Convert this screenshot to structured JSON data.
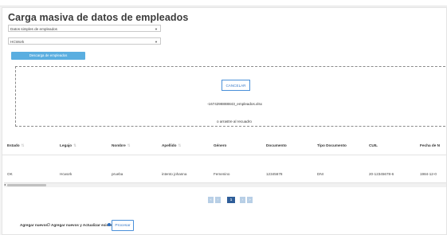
{
  "page": {
    "title": "Carga masiva de datos de empleados"
  },
  "selects": {
    "type_value": "Datos simples de empleados",
    "company_value": "HCWork"
  },
  "buttons": {
    "download": "Descarga de empleados",
    "cancel": "CANCELAR",
    "process": "Procesar"
  },
  "dropzone": {
    "filename": "-1674298888843_empleados.xlsx",
    "drag_text": "o arrastre al recuadro"
  },
  "table": {
    "columns": [
      "Estado",
      "Legajo",
      "Nombre",
      "Apellido",
      "Género",
      "Documento",
      "Tipo Documento",
      "CUIL",
      "Fecha de N"
    ],
    "sortable": [
      true,
      true,
      true,
      true,
      false,
      false,
      false,
      false,
      false
    ],
    "rows": [
      [
        "OK",
        "Hcwork",
        "prueba",
        "intento johanna",
        "Femenino",
        "12345678",
        "DNI",
        "20-12345678-6",
        "1984-12-0"
      ]
    ]
  },
  "pagination": {
    "current_page": "1"
  },
  "footer": {
    "add_new_label": "Agregar nuevos",
    "add_update_label": "Agregar nuevos y Actualizar existentes",
    "selected_option": "add_update"
  },
  "colors": {
    "primary_button": "#5aaee0",
    "page_current": "#2f5e99",
    "outline_blue": "#4a90d9"
  }
}
